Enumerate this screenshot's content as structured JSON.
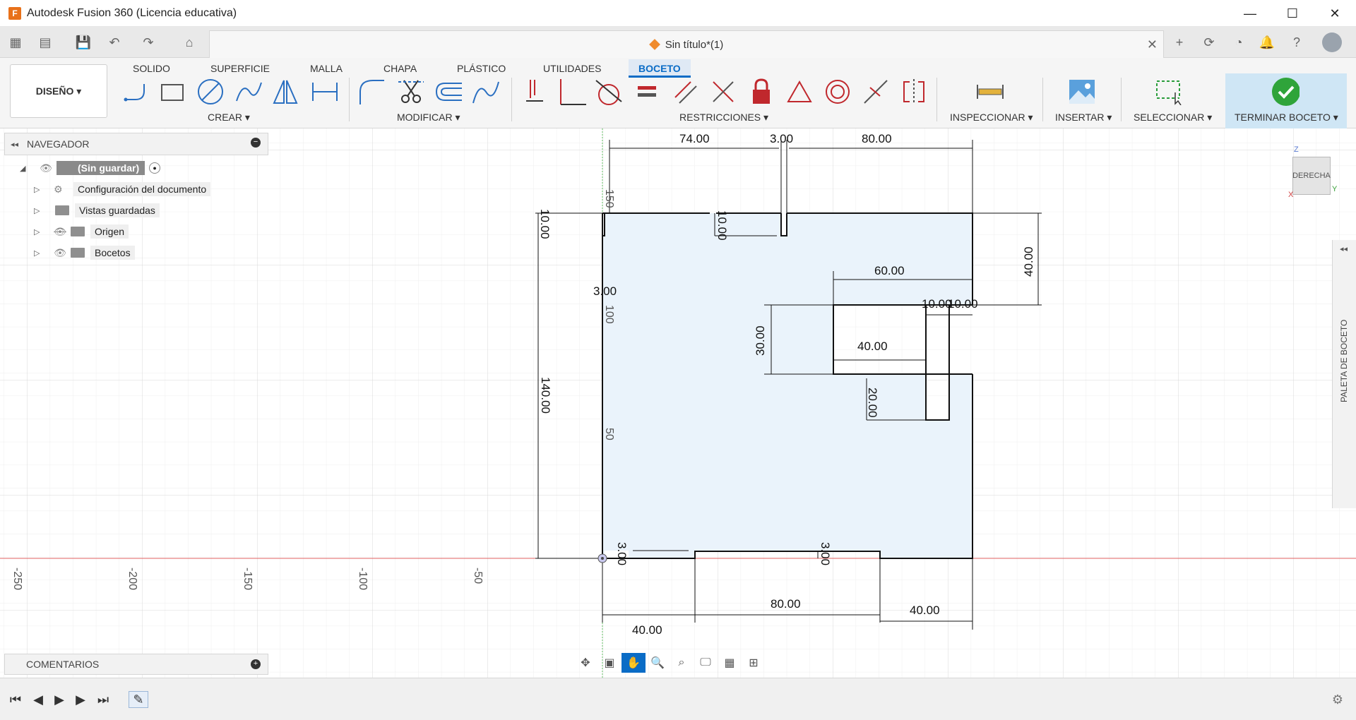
{
  "window": {
    "title": "Autodesk Fusion 360 (Licencia educativa)",
    "logo": "F"
  },
  "document_tab": {
    "title": "Sin título*(1)"
  },
  "workspace": {
    "label": "DISEÑO ▾"
  },
  "ribbon_tabs": [
    "SOLIDO",
    "SUPERFICIE",
    "MALLA",
    "CHAPA",
    "PLÁSTICO",
    "UTILIDADES",
    "BOCETO"
  ],
  "active_tab": "BOCETO",
  "groups": {
    "crear": "CREAR ▾",
    "modificar": "MODIFICAR ▾",
    "restricciones": "RESTRICCIONES ▾",
    "inspeccionar": "INSPECCIONAR ▾",
    "insertar": "INSERTAR ▾",
    "seleccionar": "SELECCIONAR ▾",
    "terminar": "TERMINAR BOCETO ▾"
  },
  "navigator": {
    "title": "NAVEGADOR",
    "root": "(Sin guardar)",
    "items": [
      {
        "label": "Configuración del documento",
        "icon": "gear-icon"
      },
      {
        "label": "Vistas guardadas",
        "icon": "folder-icon"
      },
      {
        "label": "Origen",
        "icon": "folder-icon"
      },
      {
        "label": "Bocetos",
        "icon": "folder-icon"
      }
    ]
  },
  "comments": {
    "title": "COMENTARIOS"
  },
  "palette": {
    "label": "PALETA DE BOCETO"
  },
  "viewcube": {
    "face": "DERECHA",
    "z": "Z",
    "y": "Y",
    "x": "X"
  },
  "sketch": {
    "dimensions": [
      "74.00",
      "3.00",
      "80.00",
      "10.00",
      "10.00",
      "40.00",
      "60.00",
      "3.00",
      "10.00",
      "10.00",
      "30.00",
      "40.00",
      "20.00",
      "140.00",
      "40.00",
      "80.00",
      "40.00",
      "3.00",
      "3.00"
    ],
    "axis_labels": [
      "-250",
      "-200",
      "-150",
      "-100",
      "-50",
      "150",
      "100",
      "50"
    ]
  }
}
